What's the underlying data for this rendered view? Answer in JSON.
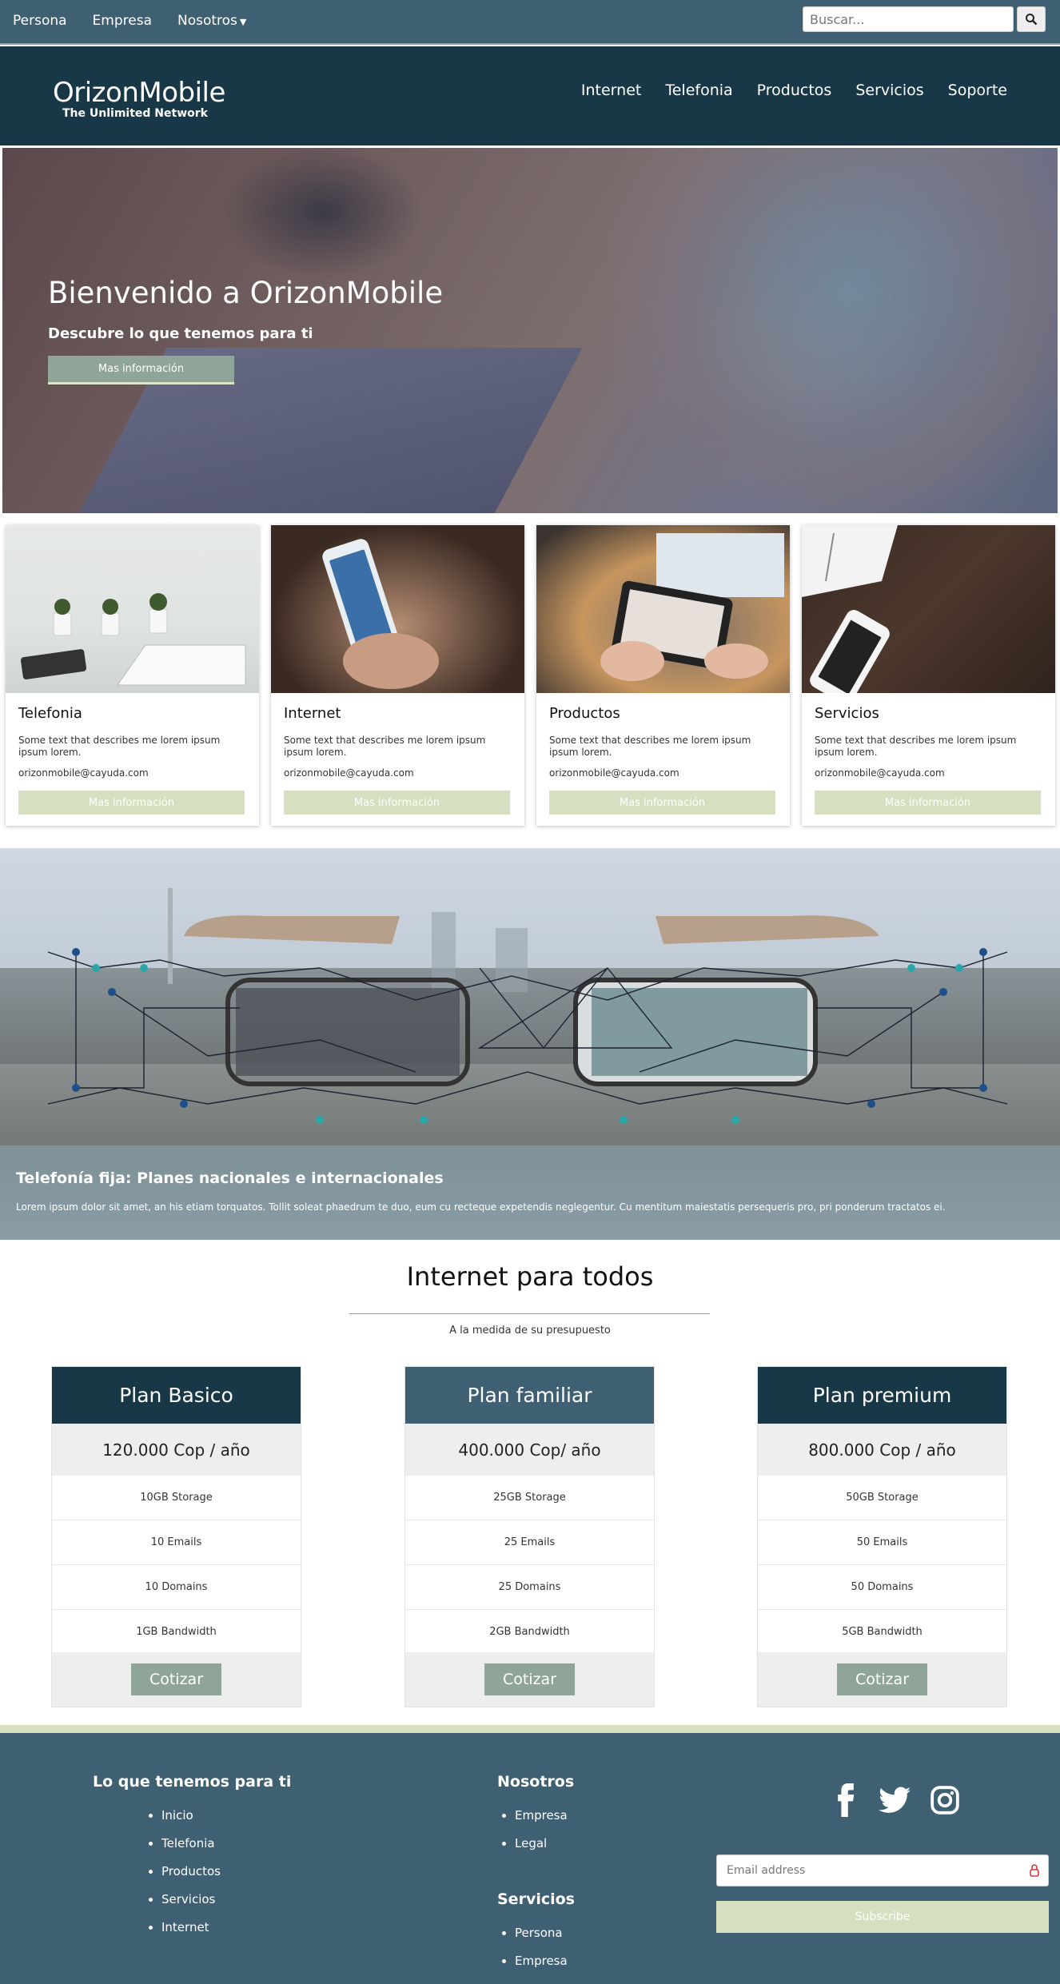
{
  "topbar": {
    "links": [
      "Persona",
      "Empresa",
      "Nosotros"
    ],
    "search_placeholder": "Buscar..."
  },
  "header": {
    "brand": "OrizonMobile",
    "tagline": "The Unlimited Network",
    "nav": [
      "Internet",
      "Telefonia",
      "Productos",
      "Servicios",
      "Soporte"
    ]
  },
  "hero": {
    "title": "Bienvenido a OrizonMobile",
    "subtitle": "Descubre lo que tenemos para ti",
    "button": "Mas información"
  },
  "cards": [
    {
      "title": "Telefonia",
      "text": "Some text that describes me lorem ipsum ipsum lorem.",
      "email": "orizonmobile@cayuda.com",
      "button": "Mas información"
    },
    {
      "title": "Internet",
      "text": "Some text that describes me lorem ipsum ipsum lorem.",
      "email": "orizonmobile@cayuda.com",
      "button": "Mas información"
    },
    {
      "title": "Productos",
      "text": "Some text that describes me lorem ipsum ipsum lorem.",
      "email": "orizonmobile@cayuda.com",
      "button": "Mas información"
    },
    {
      "title": "Servicios",
      "text": "Some text that describes me lorem ipsum ipsum lorem.",
      "email": "orizonmobile@cayuda.com",
      "button": "Mas información"
    }
  ],
  "banner": {
    "title": "Telefonía fija: Planes nacionales e internacionales",
    "text": "Lorem ipsum dolor sit amet, an his etiam torquatos. Tollit soleat phaedrum te duo, eum cu recteque expetendis neglegentur. Cu mentitum maiestatis persequeris pro, pri ponderum tractatos ei."
  },
  "pricing": {
    "title": "Internet para todos",
    "subtitle": "A la medida de su presupuesto",
    "plans": [
      {
        "name": "Plan Basico",
        "price": "120.000 Cop / año",
        "features": [
          "10GB Storage",
          "10 Emails",
          "10 Domains",
          "1GB Bandwidth"
        ],
        "button": "Cotizar",
        "color": "#193847"
      },
      {
        "name": "Plan familiar",
        "price": "400.000 Cop/ año",
        "features": [
          "25GB Storage",
          "25 Emails",
          "25 Domains",
          "2GB Bandwidth"
        ],
        "button": "Cotizar",
        "color": "#3f6072"
      },
      {
        "name": "Plan premium",
        "price": "800.000 Cop / año",
        "features": [
          "50GB Storage",
          "50 Emails",
          "50 Domains",
          "5GB Bandwidth"
        ],
        "button": "Cotizar",
        "color": "#193847"
      }
    ]
  },
  "footer": {
    "col1_title": "Lo que tenemos para ti",
    "col1_items": [
      "Inicio",
      "Telefonia",
      "Productos",
      "Servicios",
      "Internet"
    ],
    "col2_title": "Nosotros",
    "col2_items": [
      "Empresa",
      "Legal"
    ],
    "col3_title": "Servicios",
    "col3_items": [
      "Persona",
      "Empresa"
    ],
    "social_icons": [
      "facebook-icon",
      "twitter-icon",
      "instagram-icon"
    ],
    "email_placeholder": "Email address",
    "subscribe": "Subscribe"
  },
  "colors": {
    "topbar": "#3f6072",
    "header": "#193847",
    "accent": "#d6dfc0",
    "button": "#8fa59a"
  }
}
